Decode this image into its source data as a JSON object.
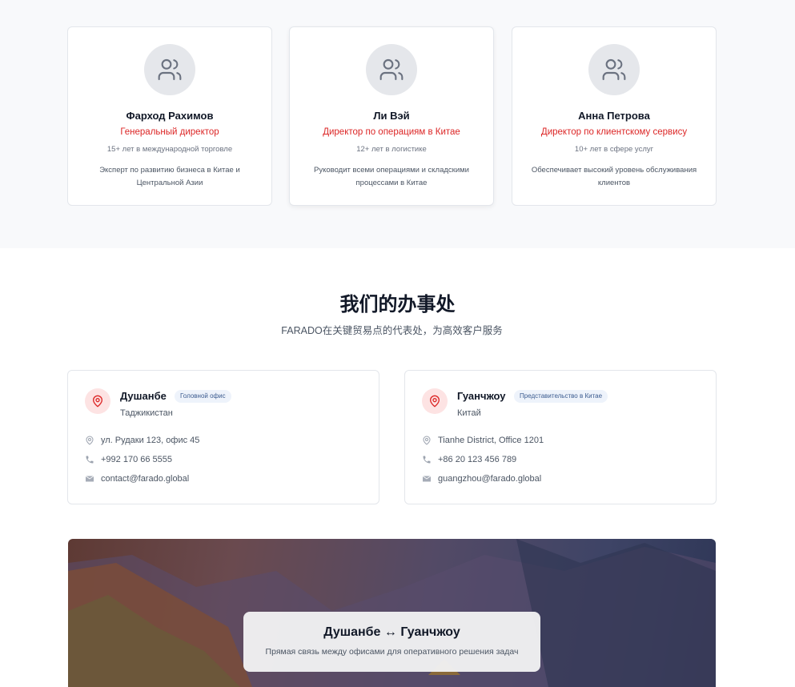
{
  "team": {
    "members": [
      {
        "name": "Фарход Рахимов",
        "role": "Генеральный директор",
        "experience": "15+ лет в международной торговле",
        "description": "Эксперт по развитию бизнеса в Китае и Центральной Азии",
        "icon": "users-icon"
      },
      {
        "name": "Ли Вэй",
        "role": "Директор по операциям в Китае",
        "experience": "12+ лет в логистике",
        "description": "Руководит всеми операциями и складскими процессами в Китае",
        "icon": "users-icon"
      },
      {
        "name": "Анна Петрова",
        "role": "Директор по клиентскому сервису",
        "experience": "10+ лет в сфере услуг",
        "description": "Обеспечивает высокий уровень обслуживания клиентов",
        "icon": "users-icon"
      }
    ]
  },
  "offices": {
    "title": "我们的办事处",
    "subtitle": "FARADO在关键贸易点的代表处，为高效客户服务",
    "items": [
      {
        "city": "Душанбе",
        "badge": "Головной офис",
        "country": "Таджикистан",
        "address": "ул. Рудаки 123, офис 45",
        "phone": "+992 170 66 5555",
        "email": "contact@farado.global"
      },
      {
        "city": "Гуанчжоу",
        "badge": "Представительство в Китае",
        "country": "Китай",
        "address": "Tianhe District, Office 1201",
        "phone": "+86 20 123 456 789",
        "email": "guangzhou@farado.global"
      }
    ]
  },
  "banner": {
    "title": "Душанбе ↔ Гуанчжоу",
    "subtitle": "Прямая связь между офисами для оперативного решения задач"
  },
  "colors": {
    "accent": "#dc2626",
    "badge_bg": "#eef3fb",
    "section_bg": "#f8f9fb"
  }
}
